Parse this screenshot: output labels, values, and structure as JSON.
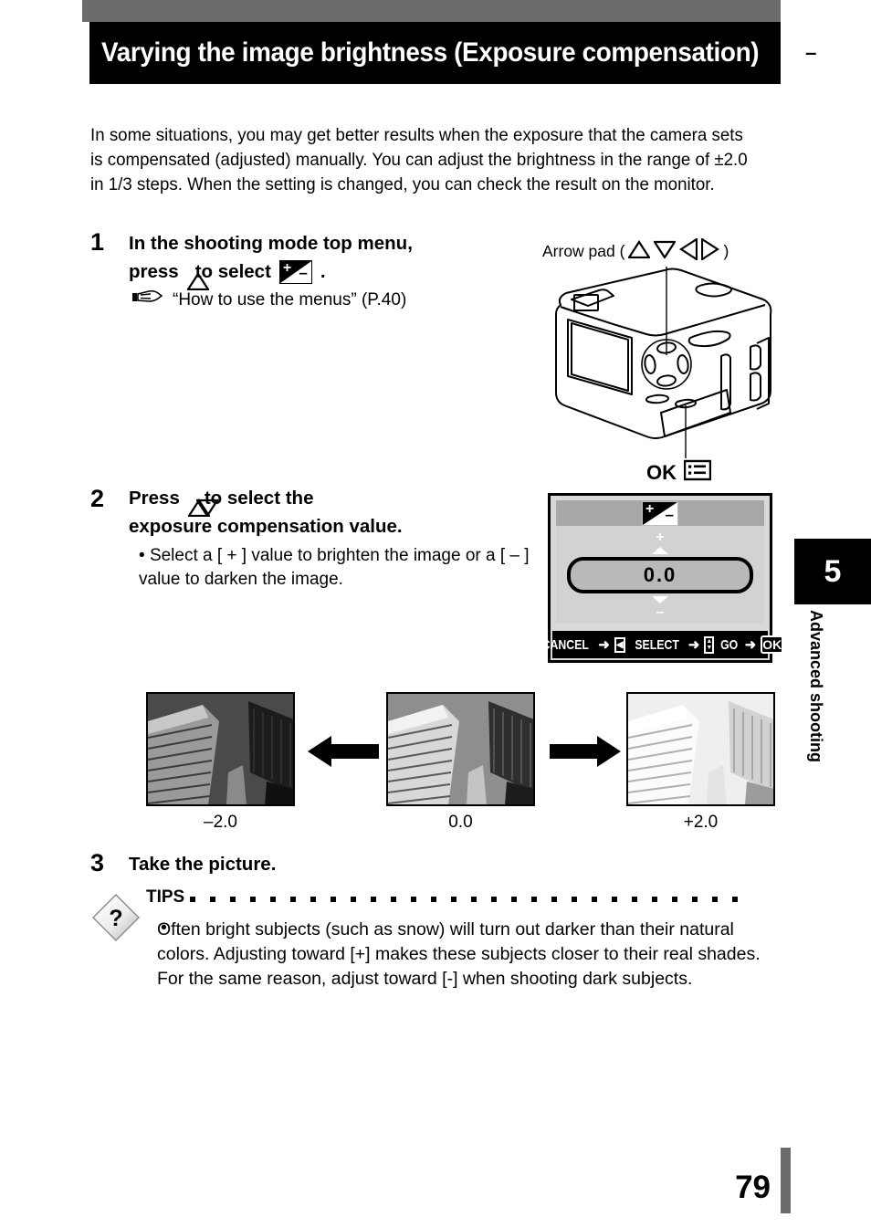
{
  "page": {
    "title": "Varying the image brightness (Exposure compensation)",
    "title_icon": "exposure-compensation-icon",
    "number": "79"
  },
  "intro": {
    "text": "In some situations, you may get better results when the exposure that the camera sets is compensated (adjusted) manually. You can adjust the brightness in the range of ±2.0 in 1/3 steps. When the setting is changed, you can check the result on the monitor."
  },
  "steps": [
    {
      "number": "1",
      "heading_part1": "In the shooting mode top menu,",
      "heading_part2a": "press",
      "heading_part2b": "to select",
      "heading_part2c": ".",
      "reference": "“How to use the menus” (P.40)"
    },
    {
      "number": "2",
      "heading_part1a": "Press",
      "heading_part1b": "to select the",
      "heading_part2": "exposure compensation value.",
      "bullet": "Select a [ + ] value to brighten the image or a [ – ] value to darken the image."
    },
    {
      "number": "3",
      "heading": "Take the picture."
    }
  ],
  "camera_figure": {
    "arrow_pad_label_prefix": "Arrow pad (",
    "arrow_pad_label_suffix": ")",
    "arrow_glyphs": [
      "up-triangle",
      "down-triangle",
      "left-triangle",
      "right-triangle"
    ],
    "ok_label": "OK",
    "menu_icon": "menu-list-icon"
  },
  "lcd": {
    "title_icon": "exposure-compensation-icon",
    "plus_marker": "+",
    "minus_marker": "–",
    "value": "0.0",
    "footer": {
      "cancel_label": "CANCEL",
      "cancel_key": "◀",
      "select_label": "SELECT",
      "select_key": "▲▼",
      "go_label": "GO",
      "go_key": "OK",
      "arrow": "➜"
    }
  },
  "samples": {
    "items": [
      {
        "label": "–2.0",
        "brightness": "dark"
      },
      {
        "label": "0.0",
        "brightness": "normal"
      },
      {
        "label": "+2.0",
        "brightness": "bright"
      }
    ],
    "left_arrow": "arrow-left",
    "right_arrow": "arrow-right"
  },
  "tips": {
    "icon": "question-diamond-icon",
    "label": "TIPS",
    "bullet": "•",
    "body": "Often bright subjects (such as snow) will turn out darker than their natural colors. Adjusting toward [+] makes these subjects closer to their real shades. For the same reason, adjust toward [-] when shooting dark subjects."
  },
  "chapter": {
    "number": "5",
    "label": "Advanced shooting"
  },
  "colors": {
    "banner_bg": "#000000",
    "top_bar": "#6b6b6b",
    "lcd_bg": "#d2d2d2",
    "lcd_titlebar": "#a8a8a8",
    "pill_bg": "#b9b9b9"
  }
}
